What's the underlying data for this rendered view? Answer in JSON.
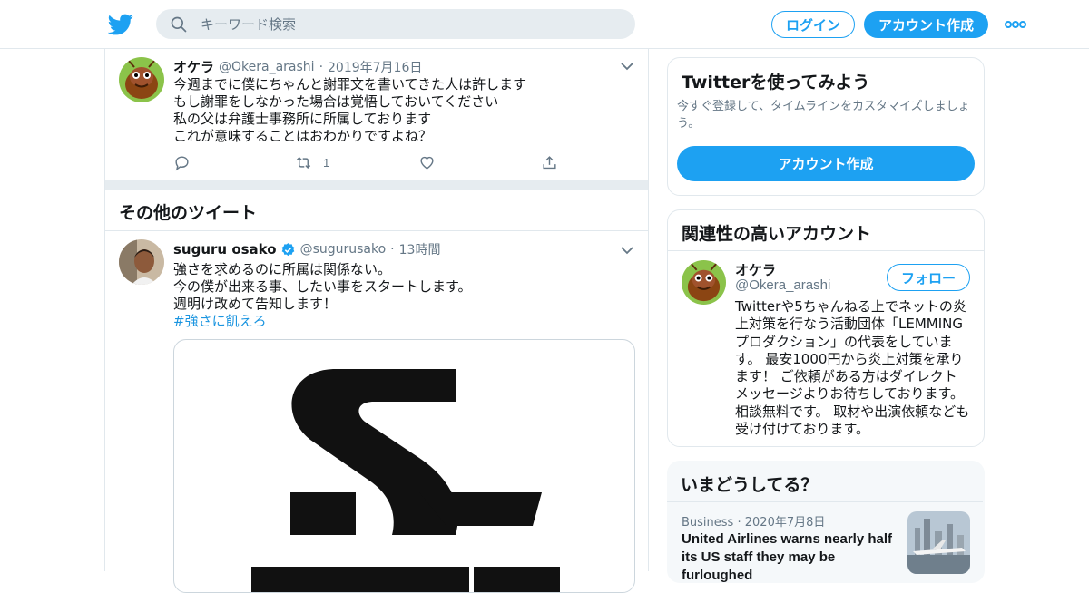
{
  "header": {
    "search_placeholder": "キーワード検索",
    "login_label": "ログイン",
    "signup_label": "アカウント作成",
    "logo_icon": "twitter-bird-icon",
    "brand_color": "#1da1f2"
  },
  "main_tweet": {
    "name": "オケラ",
    "handle": "@Okera_arashi",
    "dot": "·",
    "date": "2019年7月16日",
    "lines": [
      "今週までに僕にちゃんと謝罪文を書いてきた人は許します",
      "もし謝罪をしなかった場合は覚悟しておいてください",
      "私の父は弁護士事務所に所属しております",
      "これが意味することはおわかりですよね？"
    ],
    "retweet_count": "1"
  },
  "more_tweets": {
    "title": "その他のツイート",
    "tweet": {
      "name": "suguru osako",
      "handle": "@sugurusako",
      "dot": "·",
      "time": "13時間",
      "lines": [
        "強さを求めるのに所属は関係ない。",
        "今の僕が出来る事、したい事をスタートします。",
        "週明け改めて告知します！"
      ],
      "hashtag": "#強さに飢えろ"
    }
  },
  "try_card": {
    "title": "Twitterを使ってみよう",
    "subtitle": "今すぐ登録して、タイムラインをカスタマイズしましょう。",
    "button": "アカウント作成"
  },
  "related_card": {
    "title": "関連性の高いアカウント",
    "name": "オケラ",
    "handle": "@Okera_arashi",
    "follow_label": "フォロー",
    "bio_lines": [
      "Twitterや5ちゃんねる上でネットの炎",
      "上対策を行なう活動団体「LEMMING",
      "プロダクション」の代表をしていま",
      "す。 最安1000円から炎上対策を承り",
      "ます！ ご依頼がある方はダイレクト",
      "メッセージよりお待ちしております。",
      "相談無料です。 取材や出演依頼なども",
      "受け付けております。"
    ]
  },
  "trends_card": {
    "title": "いまどうしてる？",
    "category": "Business",
    "dot": "·",
    "date": "2020年7月8日",
    "headline": "United Airlines warns nearly half its US staff they may be furloughed"
  }
}
